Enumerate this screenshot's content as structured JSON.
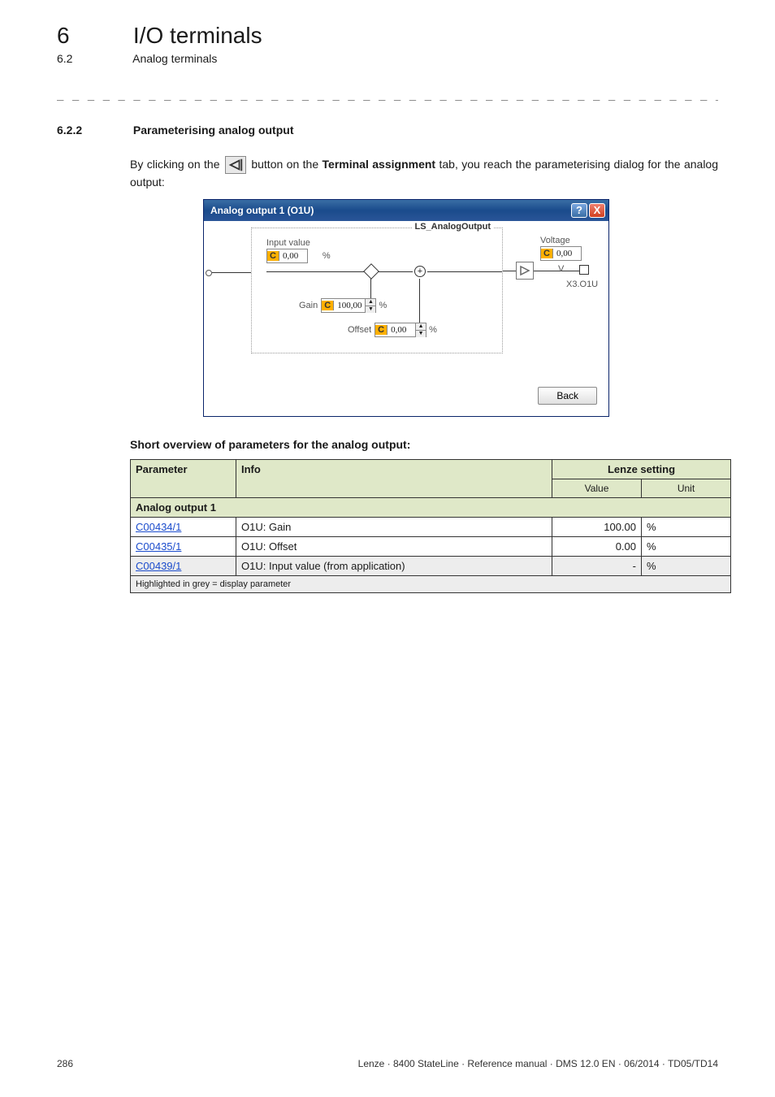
{
  "header": {
    "chapter_num": "6",
    "chapter_title": "I/O terminals",
    "section_num": "6.2",
    "section_title": "Analog terminals",
    "dashes": "_ _ _ _ _ _ _ _ _ _ _ _ _ _ _ _ _ _ _ _ _ _ _ _ _ _ _ _ _ _ _ _ _ _ _ _ _ _ _ _ _ _ _ _ _ _ _ _ _ _ _ _ _ _ _ _ _ _ _ _ _ _ _ _"
  },
  "subsection": {
    "num": "6.2.2",
    "title": "Parameterising analog output",
    "intro_before": "By clicking on the ",
    "intro_mid": " button on the ",
    "intro_bold": "Terminal assignment",
    "intro_after": "  tab, you reach the parameterising dialog for the analog output:"
  },
  "dialog": {
    "title": "Analog output 1 (O1U)",
    "help": "?",
    "close": "X",
    "group_label": "LS_AnalogOutput",
    "input_label": "Input value",
    "input_value": "0,00",
    "input_unit": "%",
    "gain_label": "Gain",
    "gain_value": "100,00",
    "gain_unit": "%",
    "offset_label": "Offset",
    "offset_value": "0,00",
    "offset_unit": "%",
    "voltage_label": "Voltage",
    "voltage_value": "0,00",
    "voltage_unit": "V",
    "terminal": "X3.O1U",
    "back": "Back"
  },
  "h4": "Short overview of parameters for the analog output:",
  "table": {
    "head_param": "Parameter",
    "head_info": "Info",
    "head_lenze": "Lenze setting",
    "sub_value": "Value",
    "sub_unit": "Unit",
    "group": "Analog output 1",
    "rows": [
      {
        "code": "C00434/1",
        "info": "O1U: Gain",
        "value": "100.00",
        "unit": "%",
        "gray": false
      },
      {
        "code": "C00435/1",
        "info": "O1U: Offset",
        "value": "0.00",
        "unit": "%",
        "gray": false
      },
      {
        "code": "C00439/1",
        "info": "O1U: Input value (from application)",
        "value": "-",
        "unit": "%",
        "gray": true
      }
    ],
    "footnote": "Highlighted in grey = display parameter"
  },
  "footer": {
    "page": "286",
    "ref": "Lenze · 8400 StateLine · Reference manual · DMS 12.0 EN · 06/2014 · TD05/TD14"
  }
}
